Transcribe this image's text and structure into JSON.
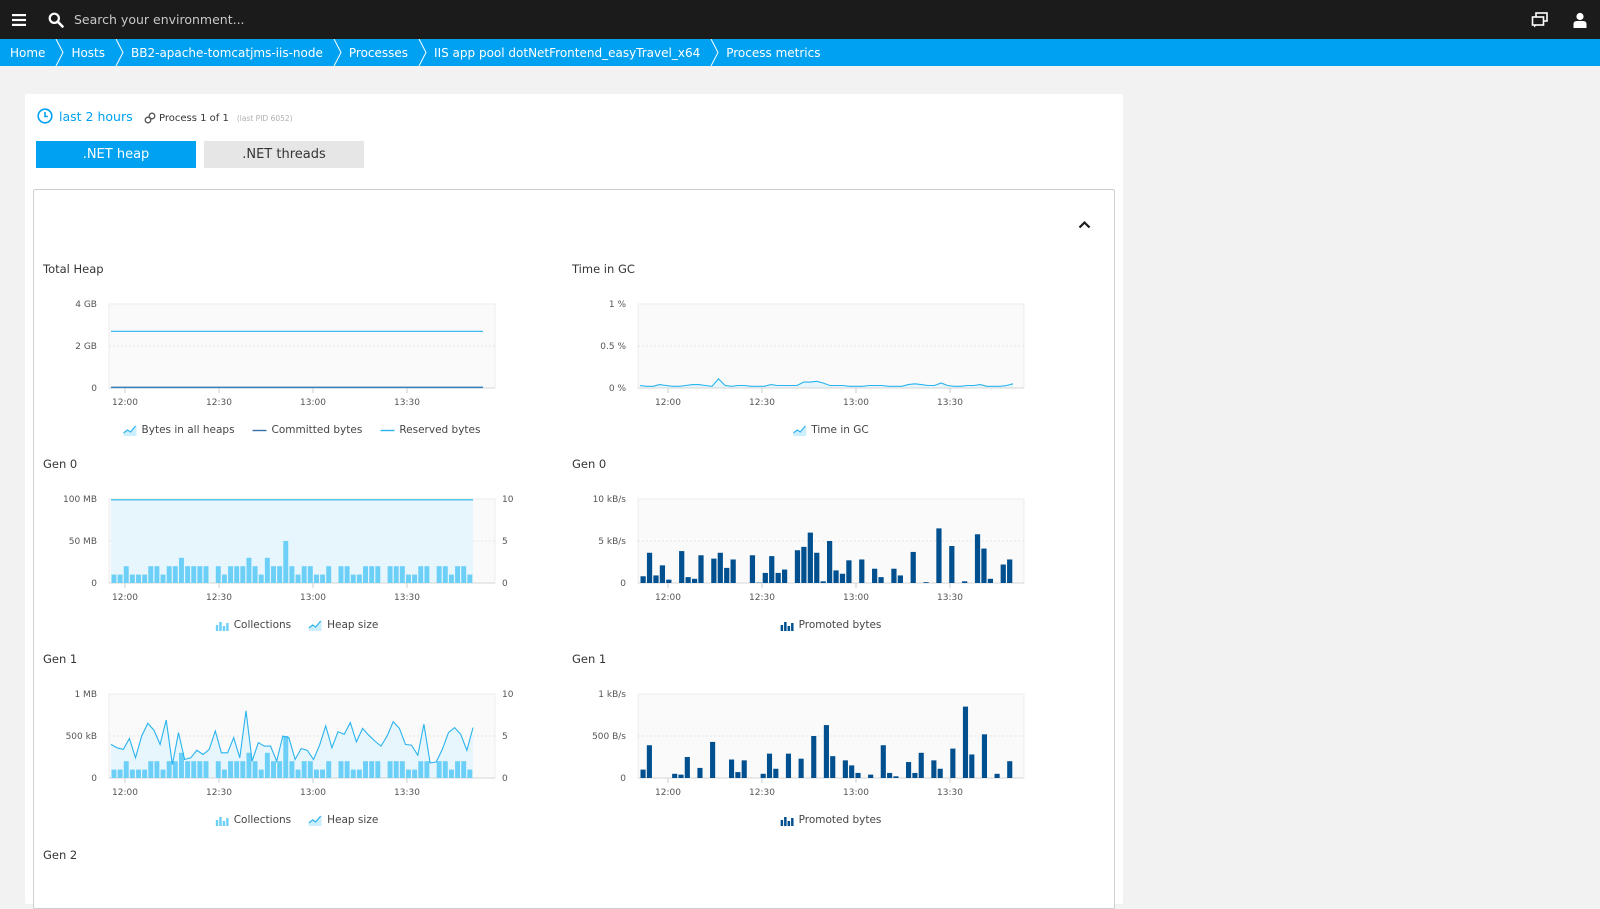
{
  "topbar": {
    "menu_icon": "hamburger-menu-icon",
    "search_icon": "search-icon",
    "search_placeholder": "Search your environment...",
    "icons": [
      "chat-icon",
      "user-icon"
    ]
  },
  "breadcrumb": [
    "Home",
    "Hosts",
    "BB2-apache-tomcatjms-iis-node",
    "Processes",
    "IIS app pool dotNetFrontend_easyTravel_x64",
    "Process metrics"
  ],
  "toolbar": {
    "timeframe": "last 2 hours",
    "process_label": "Process 1 of 1",
    "process_pid": "(last PID 6052)"
  },
  "tabs": [
    {
      "label": ".NET heap",
      "active": true
    },
    {
      "label": ".NET threads",
      "active": false
    }
  ],
  "colors": {
    "accent": "#00a1f1",
    "light_blue": "#6ccff7",
    "dark_blue": "#00508f",
    "line_blue": "#2ab3ee",
    "area_fill": "#e2f4fc"
  },
  "chart_data": [
    {
      "id": "total-heap",
      "type": "line",
      "title": "Total Heap",
      "x_ticks": [
        "12:00",
        "12:30",
        "13:00",
        "13:30"
      ],
      "y_ticks": [
        "4 GB",
        "2 GB",
        "0"
      ],
      "ylim": [
        0,
        4
      ],
      "yunit": "GB",
      "series": [
        {
          "name": "Bytes in all heaps",
          "kind": "area",
          "values_const": 0.02
        },
        {
          "name": "Committed bytes",
          "kind": "line",
          "values_const": 0.04
        },
        {
          "name": "Reserved bytes",
          "kind": "line",
          "values_const": 2.7
        }
      ],
      "legend": [
        "Bytes in all heaps",
        "Committed bytes",
        "Reserved bytes"
      ]
    },
    {
      "id": "time-in-gc",
      "type": "line",
      "title": "Time in GC",
      "x_ticks": [
        "12:00",
        "12:30",
        "13:00",
        "13:30"
      ],
      "y_ticks": [
        "1 %",
        "0.5 %",
        "0 %"
      ],
      "ylim": [
        0,
        1
      ],
      "yunit": "%",
      "series": [
        {
          "name": "Time in GC",
          "kind": "area",
          "values": [
            0.03,
            0.02,
            0.02,
            0.04,
            0.03,
            0.02,
            0.02,
            0.03,
            0.04,
            0.04,
            0.03,
            0.02,
            0.11,
            0.03,
            0.02,
            0.03,
            0.03,
            0.02,
            0.02,
            0.02,
            0.04,
            0.03,
            0.03,
            0.03,
            0.03,
            0.07,
            0.07,
            0.08,
            0.06,
            0.03,
            0.03,
            0.03,
            0.02,
            0.02,
            0.02,
            0.03,
            0.03,
            0.03,
            0.02,
            0.02,
            0.02,
            0.04,
            0.05,
            0.04,
            0.03,
            0.03,
            0.06,
            0.03,
            0.02,
            0.02,
            0.03,
            0.03,
            0.04,
            0.02,
            0.02,
            0.02,
            0.03,
            0.05
          ]
        }
      ],
      "legend": [
        "Time in GC"
      ]
    },
    {
      "id": "gen0-heap",
      "type": "bar",
      "title": "Gen 0",
      "x_ticks": [
        "12:00",
        "12:30",
        "13:00",
        "13:30"
      ],
      "y_ticks": [
        "100 MB",
        "50 MB",
        "0"
      ],
      "y2_ticks": [
        "10",
        "5",
        "0"
      ],
      "ylim": [
        0,
        100
      ],
      "y2lim": [
        0,
        10
      ],
      "series": [
        {
          "name": "Collections",
          "kind": "bar",
          "axis": "right",
          "values": [
            1,
            1,
            2,
            1,
            1,
            1,
            2,
            2,
            1,
            2,
            2,
            3,
            2,
            2,
            2,
            2,
            0,
            2,
            1,
            2,
            2,
            2,
            3,
            2,
            1,
            3,
            2,
            2,
            5,
            2,
            1,
            2,
            2,
            1,
            1,
            2,
            0,
            2,
            2,
            1,
            1,
            2,
            2,
            2,
            0,
            2,
            2,
            2,
            1,
            1,
            2,
            2,
            0,
            2,
            2,
            1,
            2,
            2,
            1
          ]
        },
        {
          "name": "Heap size",
          "kind": "area",
          "axis": "left",
          "values_const": 99
        }
      ],
      "legend": [
        "Collections",
        "Heap size"
      ]
    },
    {
      "id": "gen0-promoted",
      "type": "bar",
      "title": "Gen 0",
      "x_ticks": [
        "12:00",
        "12:30",
        "13:00",
        "13:30"
      ],
      "y_ticks": [
        "10 kB/s",
        "5 kB/s",
        "0"
      ],
      "ylim": [
        0,
        10
      ],
      "series": [
        {
          "name": "Promoted bytes",
          "kind": "bar",
          "values": [
            0.8,
            3.6,
            0.9,
            2.1,
            0.4,
            0,
            3.8,
            0.7,
            0.5,
            3.3,
            0,
            2.9,
            3.6,
            1.8,
            2.8,
            0,
            0,
            3.3,
            0.05,
            1.2,
            3.2,
            1.2,
            1.6,
            0,
            3.9,
            4.3,
            6.0,
            3.6,
            0.2,
            5.0,
            1.5,
            1.1,
            2.7,
            0,
            2.8,
            0,
            1.7,
            0.7,
            0,
            1.7,
            0.9,
            0,
            3.7,
            0,
            0.1,
            0,
            6.5,
            0,
            4.4,
            0,
            0.2,
            0,
            5.8,
            4.1,
            0.5,
            0,
            2.2,
            2.8
          ]
        }
      ],
      "legend": [
        "Promoted bytes"
      ]
    },
    {
      "id": "gen1-heap",
      "type": "bar",
      "title": "Gen 1",
      "x_ticks": [
        "12:00",
        "12:30",
        "13:00",
        "13:30"
      ],
      "y_ticks": [
        "1 MB",
        "500 kB",
        "0"
      ],
      "y2_ticks": [
        "10",
        "5",
        "0"
      ],
      "ylim": [
        0,
        1000
      ],
      "y2lim": [
        0,
        10
      ],
      "series": [
        {
          "name": "Collections",
          "kind": "bar",
          "axis": "right",
          "values": [
            1,
            1,
            2,
            1,
            1,
            1,
            2,
            2,
            1,
            2,
            2,
            3,
            2,
            2,
            2,
            2,
            0,
            2,
            1,
            2,
            2,
            2,
            3,
            2,
            1,
            3,
            2,
            2,
            5,
            2,
            1,
            2,
            2,
            1,
            1,
            2,
            0,
            2,
            2,
            1,
            1,
            2,
            2,
            2,
            0,
            2,
            2,
            2,
            1,
            1,
            2,
            2,
            0,
            2,
            2,
            1,
            2,
            2,
            1
          ]
        },
        {
          "name": "Heap size",
          "kind": "area",
          "axis": "left",
          "values": [
            400,
            360,
            340,
            470,
            240,
            500,
            650,
            570,
            400,
            690,
            160,
            540,
            220,
            240,
            330,
            280,
            340,
            560,
            300,
            300,
            480,
            240,
            800,
            200,
            420,
            380,
            380,
            200,
            500,
            480,
            220,
            350,
            330,
            220,
            390,
            620,
            360,
            550,
            520,
            660,
            430,
            590,
            510,
            440,
            380,
            500,
            670,
            590,
            400,
            390,
            270,
            640,
            180,
            190,
            340,
            540,
            600,
            520,
            330,
            600
          ]
        }
      ],
      "legend": [
        "Collections",
        "Heap size"
      ]
    },
    {
      "id": "gen1-promoted",
      "type": "bar",
      "title": "Gen 1",
      "x_ticks": [
        "12:00",
        "12:30",
        "13:00",
        "13:30"
      ],
      "y_ticks": [
        "1 kB/s",
        "500 B/s",
        "0"
      ],
      "ylim": [
        0,
        1000
      ],
      "series": [
        {
          "name": "Promoted bytes",
          "kind": "bar",
          "values": [
            100,
            390,
            0,
            0,
            0,
            50,
            40,
            250,
            0,
            120,
            0,
            430,
            0,
            0,
            220,
            70,
            210,
            0,
            0,
            50,
            290,
            110,
            0,
            290,
            0,
            230,
            0,
            500,
            0,
            630,
            260,
            0,
            210,
            150,
            60,
            0,
            40,
            0,
            390,
            60,
            20,
            0,
            190,
            60,
            300,
            0,
            210,
            110,
            0,
            350,
            0,
            850,
            280,
            0,
            520,
            0,
            50,
            0,
            200
          ]
        }
      ],
      "legend": [
        "Promoted bytes"
      ]
    }
  ],
  "next_section_title": "Gen 2",
  "collapse_icon": "chevron-up-icon"
}
